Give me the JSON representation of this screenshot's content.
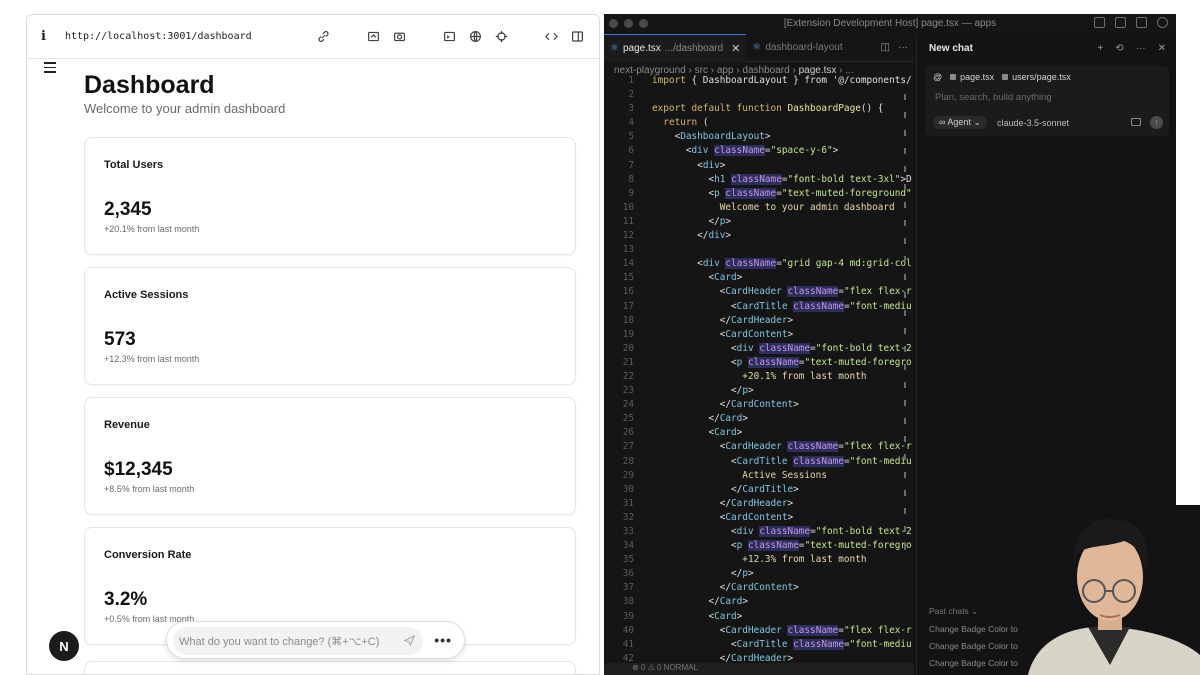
{
  "browser": {
    "info_label": "i",
    "url": "http://localhost:3001/dashboard",
    "tool_icons": [
      "link-icon",
      "screenshot-icon",
      "camera-icon",
      "terminal-icon",
      "globe-icon",
      "target-icon",
      "code-icon",
      "sidebar-icon"
    ]
  },
  "dashboard": {
    "title": "Dashboard",
    "subtitle": "Welcome to your admin dashboard",
    "cards": [
      {
        "title": "Total Users",
        "value": "2,345",
        "note": "+20.1% from last month"
      },
      {
        "title": "Active Sessions",
        "value": "573",
        "note": "+12.3% from last month"
      },
      {
        "title": "Revenue",
        "value": "$12,345",
        "note": "+8.5% from last month"
      },
      {
        "title": "Conversion Rate",
        "value": "3.2%",
        "note": "+0.5% from last month"
      }
    ]
  },
  "overlay": {
    "next_badge": "N",
    "change_placeholder": "What do you want to change? (⌘+⌥+C)",
    "more": "•••"
  },
  "editor": {
    "window_title": "[Extension Development Host] page.tsx — apps",
    "tabs": [
      {
        "name": "page.tsx",
        "path": ".../dashboard",
        "close": "✕"
      },
      {
        "name": "dashboard-layout",
        "path": ""
      }
    ],
    "breadcrumbs": [
      "next-playground",
      "src",
      "app",
      "dashboard",
      "page.tsx",
      "..."
    ],
    "code_lines": [
      {
        "n": "1",
        "text": "import { DashboardLayout } from '@/components/"
      },
      {
        "n": "2",
        "text": ""
      },
      {
        "n": "3",
        "text": "export default function DashboardPage() {"
      },
      {
        "n": "4",
        "text": "  return ("
      },
      {
        "n": "5",
        "text": "    <DashboardLayout>"
      },
      {
        "n": "6",
        "text": "      <div className=\"space-y-6\">"
      },
      {
        "n": "7",
        "text": "        <div>"
      },
      {
        "n": "8",
        "text": "          <h1 className=\"font-bold text-3xl\">D"
      },
      {
        "n": "9",
        "text": "          <p className=\"text-muted-foreground\""
      },
      {
        "n": "10",
        "text": "            Welcome to your admin dashboard"
      },
      {
        "n": "11",
        "text": "          </p>"
      },
      {
        "n": "12",
        "text": "        </div>"
      },
      {
        "n": "13",
        "text": ""
      },
      {
        "n": "14",
        "text": "        <div className=\"grid gap-4 md:grid-col"
      },
      {
        "n": "15",
        "text": "          <Card>"
      },
      {
        "n": "16",
        "text": "            <CardHeader className=\"flex flex-r"
      },
      {
        "n": "17",
        "text": "              <CardTitle className=\"font-mediu"
      },
      {
        "n": "18",
        "text": "            </CardHeader>"
      },
      {
        "n": "19",
        "text": "            <CardContent>"
      },
      {
        "n": "20",
        "text": "              <div className=\"font-bold text-2"
      },
      {
        "n": "21",
        "text": "              <p className=\"text-muted-foregro"
      },
      {
        "n": "22",
        "text": "                +20.1% from last month"
      },
      {
        "n": "23",
        "text": "              </p>"
      },
      {
        "n": "24",
        "text": "            </CardContent>"
      },
      {
        "n": "25",
        "text": "          </Card>"
      },
      {
        "n": "26",
        "text": "          <Card>"
      },
      {
        "n": "27",
        "text": "            <CardHeader className=\"flex flex-r"
      },
      {
        "n": "28",
        "text": "              <CardTitle className=\"font-mediu"
      },
      {
        "n": "29",
        "text": "                Active Sessions"
      },
      {
        "n": "30",
        "text": "              </CardTitle>"
      },
      {
        "n": "31",
        "text": "            </CardHeader>"
      },
      {
        "n": "32",
        "text": "            <CardContent>"
      },
      {
        "n": "33",
        "text": "              <div className=\"font-bold text-2"
      },
      {
        "n": "34",
        "text": "              <p className=\"text-muted-foregro"
      },
      {
        "n": "35",
        "text": "                +12.3% from last month"
      },
      {
        "n": "36",
        "text": "              </p>"
      },
      {
        "n": "37",
        "text": "            </CardContent>"
      },
      {
        "n": "38",
        "text": "          </Card>"
      },
      {
        "n": "39",
        "text": "          <Card>"
      },
      {
        "n": "40",
        "text": "            <CardHeader className=\"flex flex-r"
      },
      {
        "n": "41",
        "text": "              <CardTitle className=\"font-mediu"
      },
      {
        "n": "42",
        "text": "            </CardHeader>"
      }
    ],
    "status_bar": "⊗ 0 ⚠ 0    NORMAL"
  },
  "chat": {
    "title": "New chat",
    "context_files": [
      "page.tsx",
      "users/page.tsx"
    ],
    "placeholder": "Plan, search, build anything",
    "mode": "Agent",
    "model": "claude-3.5-sonnet",
    "past_label": "Past chats ⌄",
    "past_chats": [
      "Change Badge Color to Yellow",
      "Change Badge Color to Yellow",
      "Change Badge Color to Yellow"
    ]
  }
}
